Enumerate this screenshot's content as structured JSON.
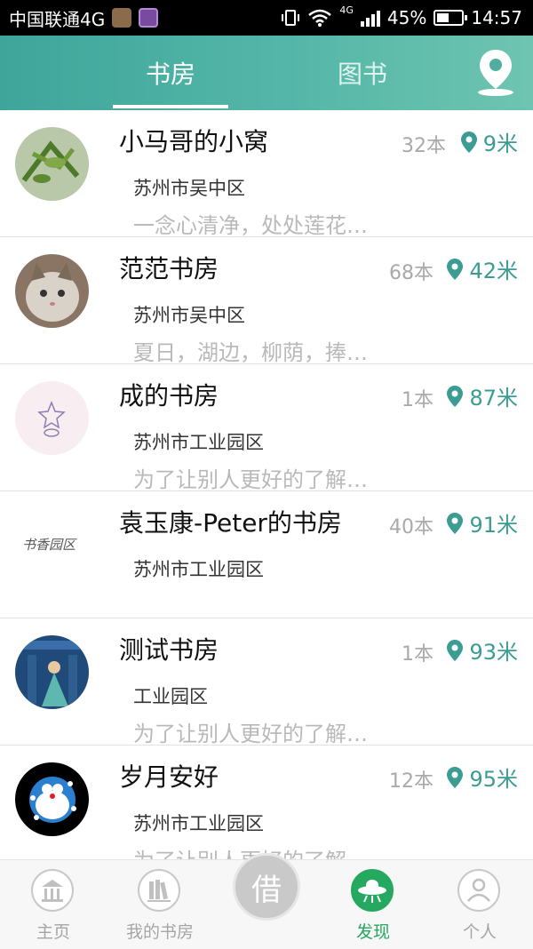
{
  "status": {
    "carrier": "中国联通4G",
    "network": "4G",
    "battery": "45%",
    "time": "14:57"
  },
  "header": {
    "tabs": [
      {
        "label": "书房",
        "active": true
      },
      {
        "label": "图书",
        "active": false
      }
    ]
  },
  "rooms": [
    {
      "name": "小马哥的小窝",
      "count": "32本",
      "distance": "9米",
      "address": "苏州市吴中区",
      "desc": "一念心清净，处处莲花…"
    },
    {
      "name": "范范书房",
      "count": "68本",
      "distance": "42米",
      "address": "苏州市吴中区",
      "desc": "夏日，湖边，柳荫，捧…"
    },
    {
      "name": "成的书房",
      "count": "1本",
      "distance": "87米",
      "address": "苏州市工业园区",
      "desc": "为了让别人更好的了解…"
    },
    {
      "name": "袁玉康-Peter的书房",
      "count": "40本",
      "distance": "91米",
      "address": "苏州市工业园区",
      "desc": ""
    },
    {
      "name": "测试书房",
      "count": "1本",
      "distance": "93米",
      "address": "工业园区",
      "desc": "为了让别人更好的了解…"
    },
    {
      "name": "岁月安好",
      "count": "12本",
      "distance": "95米",
      "address": "苏州市工业园区",
      "desc": "为了让别人更好的了解…"
    }
  ],
  "avatar_texts": {
    "shuxiang": "书香园区"
  },
  "nav": {
    "items": [
      {
        "label": "主页",
        "icon": "home-icon"
      },
      {
        "label": "我的书房",
        "icon": "bookshelf-icon"
      },
      {
        "label": "借",
        "icon": "borrow-icon"
      },
      {
        "label": "发现",
        "icon": "ufo-icon",
        "active": true
      },
      {
        "label": "个人",
        "icon": "person-icon"
      }
    ]
  },
  "colors": {
    "accent": "#3fa59b",
    "active_nav": "#25a85f",
    "distance": "#3a9c93"
  }
}
